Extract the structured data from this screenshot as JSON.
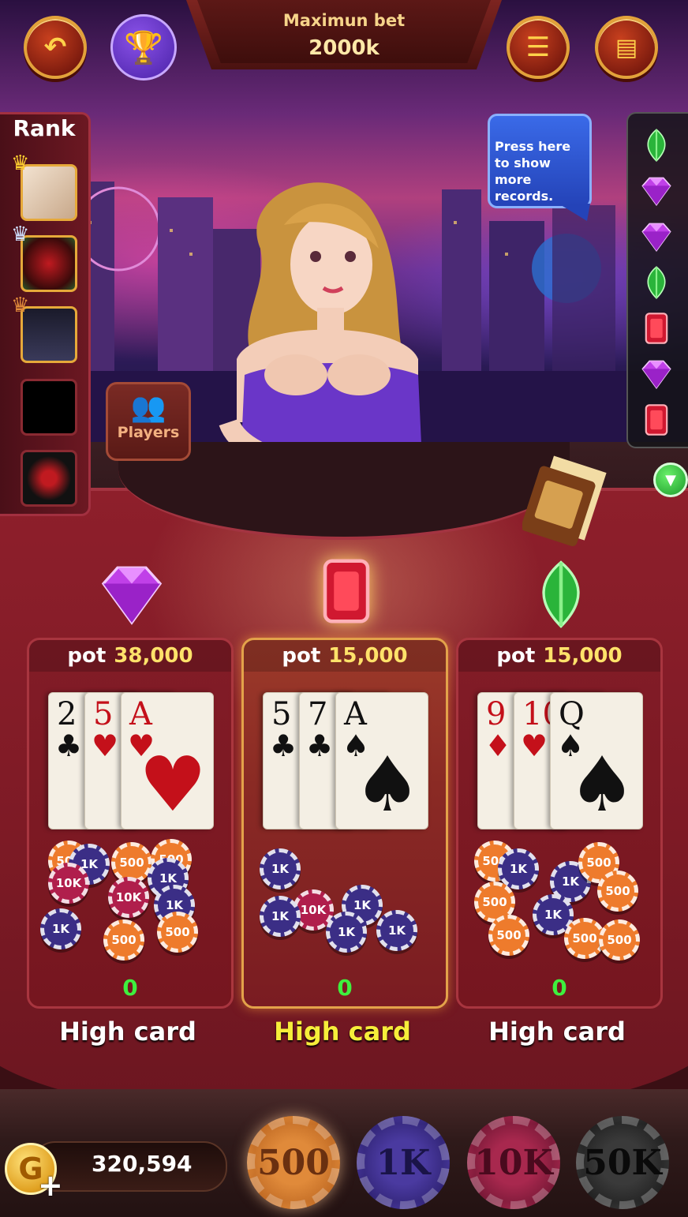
{
  "header": {
    "bet_label": "Maximun bet",
    "bet_value": "2000k"
  },
  "rank": {
    "title": "Rank"
  },
  "tooltip": {
    "text": "Press here to show more records."
  },
  "players_button": {
    "label": "Players"
  },
  "records": [
    "green-gem-icon",
    "purple-diamond-icon",
    "purple-diamond-icon",
    "green-gem-icon",
    "red-ruby-icon",
    "purple-diamond-icon",
    "red-ruby-icon"
  ],
  "pots": [
    {
      "gem": "purple-diamond-icon",
      "pot_label": "pot",
      "amount": "38,000",
      "cards": [
        {
          "rank": "2",
          "suit": "♣",
          "color": "black"
        },
        {
          "rank": "5",
          "suit": "♥",
          "color": "red"
        },
        {
          "rank": "A",
          "suit": "♥",
          "color": "red"
        }
      ],
      "score": "0",
      "hand": "High card"
    },
    {
      "gem": "red-ruby-icon",
      "pot_label": "pot",
      "amount": "15,000",
      "cards": [
        {
          "rank": "5",
          "suit": "♣",
          "color": "black"
        },
        {
          "rank": "7",
          "suit": "♣",
          "color": "black"
        },
        {
          "rank": "A",
          "suit": "♠",
          "color": "black"
        }
      ],
      "score": "0",
      "hand": "High card"
    },
    {
      "gem": "green-gem-icon",
      "pot_label": "pot",
      "amount": "15,000",
      "cards": [
        {
          "rank": "9",
          "suit": "♦",
          "color": "red"
        },
        {
          "rank": "10",
          "suit": "♥",
          "color": "red"
        },
        {
          "rank": "Q",
          "suit": "♠",
          "color": "black"
        }
      ],
      "score": "0",
      "hand": "High card"
    }
  ],
  "chips_labels": {
    "c500": "500",
    "c1k": "1K",
    "c10k": "10K"
  },
  "footer": {
    "coin_letter": "G",
    "plus": "+",
    "balance": "320,594",
    "bet_chips": [
      "500",
      "1K",
      "10K",
      "50K"
    ]
  },
  "colors": {
    "felt": "#8e1f2b",
    "gold": "#e2a23a",
    "highlight_text": "#f6ee3a",
    "score_green": "#3ef03e"
  }
}
